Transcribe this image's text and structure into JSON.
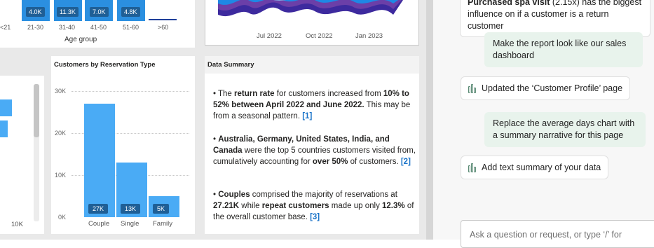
{
  "age_card": {
    "axis_title": "Age group",
    "categories": [
      "<21",
      "21-30",
      "31-40",
      "41-50",
      "51-60",
      ">60"
    ],
    "value_labels": [
      "4.0K",
      "11.3K",
      "7.0K",
      "4.8K"
    ],
    "left_value": "10K"
  },
  "timeline_card": {
    "ticks": [
      "Jul 2022",
      "Oct 2022",
      "Jan 2023"
    ]
  },
  "reservation_card": {
    "title": "Customers by Reservation Type",
    "y_ticks": [
      "30K",
      "20K",
      "10K",
      "0K"
    ],
    "bar_color": "#4aabf5",
    "label_color": "#1f5f96"
  },
  "chart_data": {
    "type": "bar",
    "title": "Customers by Reservation Type",
    "categories": [
      "Couple",
      "Single",
      "Family"
    ],
    "values": [
      27000,
      13000,
      5000
    ],
    "value_labels": [
      "27K",
      "13K",
      "5K"
    ],
    "ylim": [
      0,
      30000
    ],
    "y_ticks": [
      0,
      10000,
      20000,
      30000
    ],
    "grid": true
  },
  "summary": {
    "title": "Data Summary",
    "item1": {
      "a": "The ",
      "b1": "return rate",
      "c": " for customers increased from ",
      "b2": "10% to 52% between April 2022 and June 2022.",
      "d": " This may be from a seasonal pattern. ",
      "cite": "[1]"
    },
    "item2": {
      "b1": "Australia, Germany, United States, India, and Canada",
      "a": " were the top 5 countries customers visited from, cumulatively accounting for ",
      "b2": "over 50%",
      "c": " of customers. ",
      "cite": "[2]"
    },
    "item3": {
      "b1": "Couples",
      "a": " comprised the majority of reservations at ",
      "b2": "27.21K",
      "c": " while ",
      "b3": "repeat customers",
      "d": " made up only ",
      "b4": "12.3%",
      "e": " of the overall customer base. ",
      "cite": "[3]"
    }
  },
  "chat": {
    "top_bold": "Purchased spa visit",
    "top_rest": " (2.15x) has the biggest influence on if a customer is a return customer",
    "msg1": "Make the report look like our sales dashboard",
    "reply1": "Updated the ‘Customer Profile’ page",
    "msg2": "Replace the average days chart with a summary narrative for this page",
    "reply2": "Add text summary of your data",
    "input_placeholder": "Ask a question or request, or type ‘/’ for"
  },
  "colors": {
    "user_bubble": "#e8f3ec",
    "accent": "#1a73c8"
  }
}
